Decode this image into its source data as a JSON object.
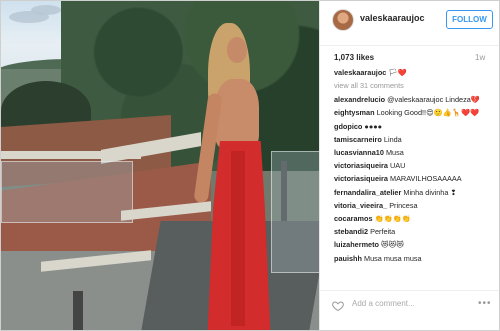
{
  "post": {
    "username": "valeskaaraujoc",
    "follow_label": "FOLLOW",
    "likes": "1,073 likes",
    "time": "1w",
    "view_all": "view all 31 comments",
    "add_comment_placeholder": "Add a comment...",
    "more_label": "•••"
  },
  "comments": [
    {
      "user": "valeskaaraujoc",
      "text": "🏳❤️"
    },
    {
      "user": "alexandrelucio",
      "text": "@valeskaaraujoc Lindeza💔"
    },
    {
      "user": "eightysman",
      "text": "Looking Good!!😍🙂👍🦒❤️❤️"
    },
    {
      "user": "gdopico",
      "text": "●●●●"
    },
    {
      "user": "tamiscarneiro",
      "text": "Linda"
    },
    {
      "user": "lucasvianna10",
      "text": "Musa"
    },
    {
      "user": "victoriasiqueira",
      "text": "UAU"
    },
    {
      "user": "victoriasiqueira",
      "text": "MARAVILHOSAAAAA"
    },
    {
      "user": "fernandalira_atelier",
      "text": "Minha divinha ❢"
    },
    {
      "user": "vitoria_vieeira_",
      "text": "Princesa"
    },
    {
      "user": "cocaramos",
      "text": "👏👏👏👏"
    },
    {
      "user": "stebandi2",
      "text": "Perfeita"
    },
    {
      "user": "luizahermeto",
      "text": "😻😻😻"
    },
    {
      "user": "pauishh",
      "text": "Musa musa musa"
    }
  ]
}
